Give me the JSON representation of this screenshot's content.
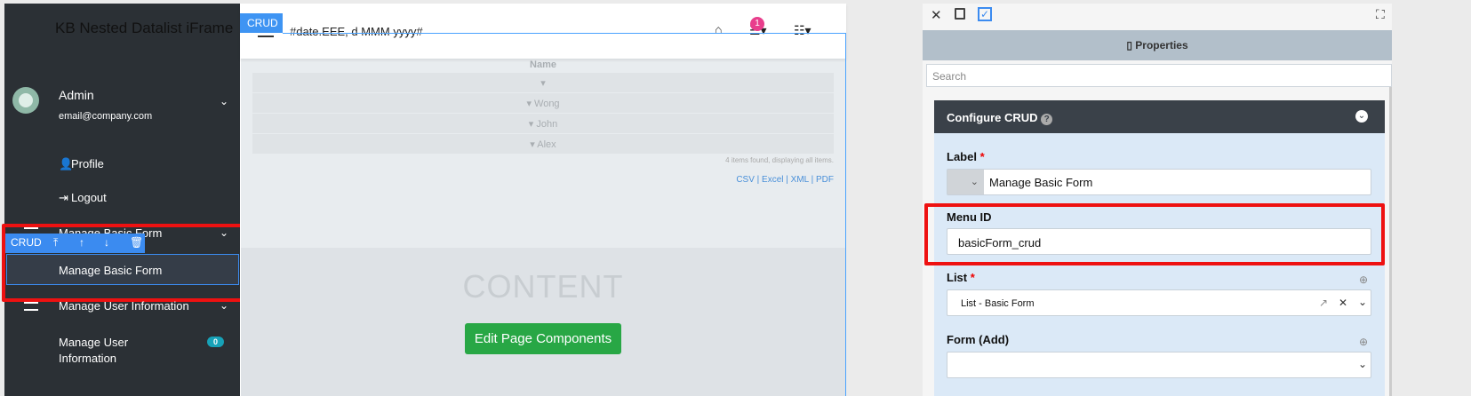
{
  "app": {
    "title": "KB Nested Datalist iFrame"
  },
  "user": {
    "name": "Admin",
    "email": "email@company.com"
  },
  "sidebar": {
    "profile": "Profile",
    "logout": "Logout",
    "manage_basic_form_header": "Manage Basic Form",
    "selected_item": "Manage Basic Form",
    "manage_user_info_header": "Manage User Information",
    "manage_user_item": "Manage User",
    "manage_user_item_line2": "Information",
    "manage_user_badge": "0"
  },
  "toolbar": {
    "crud_label": "CRUD"
  },
  "topbar": {
    "crud_tag": "CRUD",
    "date_placeholder": "#date.EEE, d MMM yyyy#",
    "notification_count": "1"
  },
  "list": {
    "column_header": "Name",
    "rows": [
      "",
      "Wong",
      "John",
      "Alex"
    ],
    "summary": "4 items found, displaying all items.",
    "exports": "CSV | Excel | XML | PDF"
  },
  "content": {
    "placeholder": "CONTENT",
    "edit_button": "Edit Page Components"
  },
  "panel": {
    "title": "Properties",
    "search_placeholder": "Search",
    "section_title": "Configure CRUD",
    "label_field": {
      "label": "Label",
      "required": "*",
      "value": "Manage Basic Form"
    },
    "menu_id_field": {
      "label": "Menu ID",
      "value": "basicForm_crud"
    },
    "list_field": {
      "label": "List",
      "required": "*",
      "value": "List - Basic Form"
    },
    "form_add_field": {
      "label": "Form (Add)",
      "value": ""
    }
  },
  "colors": {
    "accent": "#3b8bf0",
    "highlight": "#ee1111",
    "success": "#28a745",
    "sidebar": "#2b3035"
  }
}
